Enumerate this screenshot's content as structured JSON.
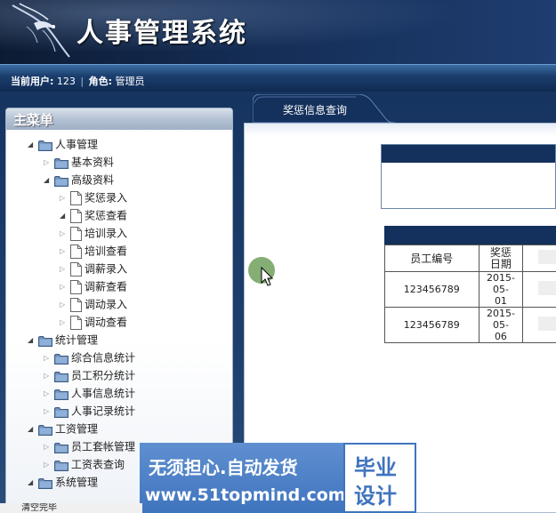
{
  "header": {
    "title": "人事管理系统"
  },
  "user_bar": {
    "current_user_label": "当前用户:",
    "current_user_value": "123",
    "separator": "|",
    "role_label": "角色:",
    "role_value": "管理员"
  },
  "menu": {
    "title": "主菜单",
    "items": [
      {
        "label": "人事管理",
        "type": "folder",
        "level": 1,
        "expanded": true
      },
      {
        "label": "基本资料",
        "type": "folder",
        "level": 2,
        "expanded": false
      },
      {
        "label": "高级资料",
        "type": "folder",
        "level": 2,
        "expanded": true
      },
      {
        "label": "奖惩录入",
        "type": "file",
        "level": 3,
        "expanded": false
      },
      {
        "label": "奖惩查看",
        "type": "file",
        "level": 3,
        "expanded": true
      },
      {
        "label": "培训录入",
        "type": "file",
        "level": 3,
        "expanded": false
      },
      {
        "label": "培训查看",
        "type": "file",
        "level": 3,
        "expanded": false
      },
      {
        "label": "调薪录入",
        "type": "file",
        "level": 3,
        "expanded": false
      },
      {
        "label": "调薪查看",
        "type": "file",
        "level": 3,
        "expanded": false
      },
      {
        "label": "调动录入",
        "type": "file",
        "level": 3,
        "expanded": false
      },
      {
        "label": "调动查看",
        "type": "file",
        "level": 3,
        "expanded": false
      },
      {
        "label": "统计管理",
        "type": "folder",
        "level": 1,
        "expanded": true
      },
      {
        "label": "综合信息统计",
        "type": "folder",
        "level": 2,
        "expanded": false
      },
      {
        "label": "员工积分统计",
        "type": "folder",
        "level": 2,
        "expanded": false
      },
      {
        "label": "人事信息统计",
        "type": "folder",
        "level": 2,
        "expanded": false
      },
      {
        "label": "人事记录统计",
        "type": "folder",
        "level": 2,
        "expanded": false
      },
      {
        "label": "工资管理",
        "type": "folder",
        "level": 1,
        "expanded": true
      },
      {
        "label": "员工套帐管理",
        "type": "folder",
        "level": 2,
        "expanded": false
      },
      {
        "label": "工资表查询",
        "type": "folder",
        "level": 2,
        "expanded": false
      },
      {
        "label": "系统管理",
        "type": "folder",
        "level": 1,
        "expanded": true
      }
    ]
  },
  "tabs": [
    {
      "label": "奖惩信息查询",
      "active": true
    }
  ],
  "result_table": {
    "headers": [
      "员工编号",
      "奖惩\n日期"
    ],
    "rows": [
      [
        "123456789",
        "2015-05-\n01"
      ],
      [
        "123456789",
        "2015-05-\n06"
      ]
    ]
  },
  "watermark": {
    "line1": "无须担心.自动发货",
    "line2": "www.51topmind.com",
    "badge_line1": "毕业",
    "badge_line2": "设计"
  },
  "status_bar": {
    "text": "清空完毕"
  },
  "colors": {
    "header_dark": "#0c1b33",
    "table_header_bar": "#14305c",
    "watermark_blue": "#3f74be",
    "click_indicator": "#6ea05a"
  },
  "icons": {
    "tree_folder": "folder-icon",
    "tree_file": "file-icon",
    "tree_expanded": "triangle-expanded-icon",
    "tree_collapsed": "triangle-collapsed-icon",
    "pointer": "mouse-cursor-icon"
  }
}
